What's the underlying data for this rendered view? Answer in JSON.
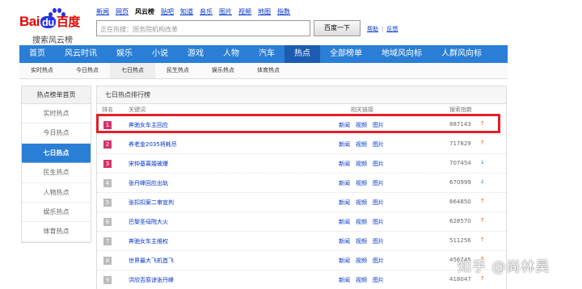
{
  "logo": {
    "word_bai": "Bai",
    "word_du": "du",
    "word_cn": "百度",
    "sub": "搜索风云榜"
  },
  "topnav": [
    "新闻",
    "网页",
    "风云榜",
    "贴吧",
    "知道",
    "音乐",
    "图片",
    "视频",
    "地图",
    "指数"
  ],
  "topnav_current": "风云榜",
  "search": {
    "placeholder": "正在热搜：国务院机构改革",
    "button": "百度一下",
    "help": "帮助",
    "feedback": "反馈"
  },
  "mainnav": [
    "首页",
    "风云时讯",
    "娱乐",
    "小说",
    "游戏",
    "人物",
    "汽车",
    "热点",
    "全部榜单",
    "地域风向标",
    "人群风向标"
  ],
  "mainnav_active": "热点",
  "subnav": [
    "实时热点",
    "今日热点",
    "七日热点",
    "民生热点",
    "娱乐热点",
    "体育热点"
  ],
  "subnav_active": "七日热点",
  "sidebar": {
    "head": "热点榜单首页",
    "items": [
      "实时热点",
      "今日热点",
      "七日热点",
      "民生热点",
      "人物热点",
      "娱乐热点",
      "体育热点"
    ],
    "active": "七日热点"
  },
  "panel": {
    "title": "七日热点排行榜",
    "headers": {
      "rank": "排名",
      "keyword": "关键词",
      "links": "相关链接",
      "index": "搜索指数"
    },
    "link_labels": [
      "新闻",
      "视频",
      "图片"
    ],
    "rows": [
      {
        "rank": "1",
        "keyword": "奔驰女车主回应",
        "index": "887143",
        "trend": "up"
      },
      {
        "rank": "2",
        "keyword": "养老金2035将耗尽",
        "index": "717829",
        "trend": "up"
      },
      {
        "rank": "3",
        "keyword": "宋仲基离婚被爆",
        "index": "707454",
        "trend": "down"
      },
      {
        "rank": "4",
        "keyword": "张丹峰回应出轨",
        "index": "670999",
        "trend": "down"
      },
      {
        "rank": "5",
        "keyword": "张扣扣案二审宣判",
        "index": "664850",
        "trend": "up"
      },
      {
        "rank": "6",
        "keyword": "巴黎圣母院大火",
        "index": "628570",
        "trend": "up"
      },
      {
        "rank": "7",
        "keyword": "奔驰女车主维权",
        "index": "511256",
        "trend": "up"
      },
      {
        "rank": "8",
        "keyword": "世界最大飞机首飞",
        "index": "456745",
        "trend": "up"
      },
      {
        "rank": "9",
        "keyword": "洪欣否原谅张丹峰",
        "index": "418047",
        "trend": "up"
      }
    ]
  },
  "watermark": "知乎 @尚林昊",
  "colors": {
    "nav_blue": "#2a7ed6",
    "nav_active": "#1b5cb0",
    "highlight": "#e1202a",
    "rank_top": "#d4336c",
    "up": "#e0650d",
    "down": "#2a7ed6"
  }
}
